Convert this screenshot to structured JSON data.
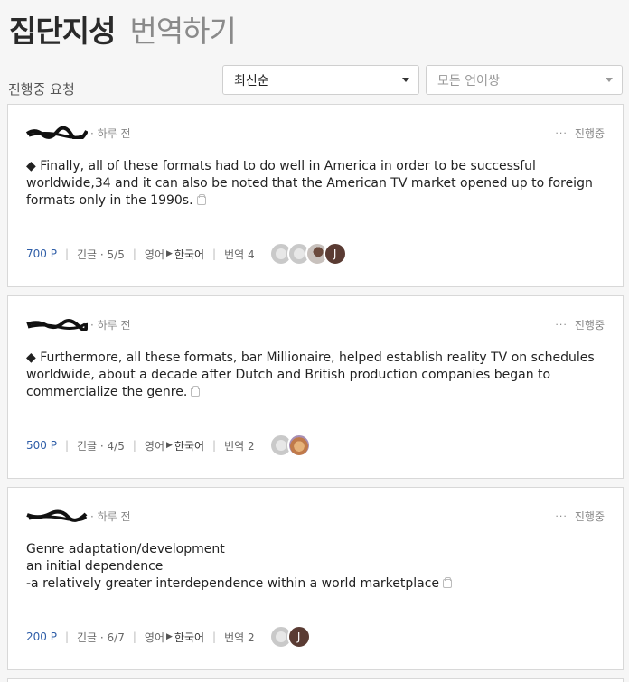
{
  "header": {
    "title_bold": "집단지성",
    "title_light": "번역하기"
  },
  "section_label": "진행중 요청",
  "filters": {
    "sort": {
      "value": "최신순"
    },
    "language_pair": {
      "placeholder": "모든 언어쌍"
    }
  },
  "requests": [
    {
      "time": "· 하루 전",
      "status": "진행중",
      "text": "◆ Finally, all of these formats had to do well in America in order to be successful worldwide,34 and it can also be noted that the American TV market opened up to foreign formats only in the 1990s.",
      "points": "700 P",
      "length": "긴글 · 5/5",
      "source_lang": "영어",
      "target_lang": "한국어",
      "translations": "번역 4",
      "avatars": [
        "grey",
        "grey",
        "photo",
        "J"
      ]
    },
    {
      "time": "· 하루 전",
      "status": "진행중",
      "text": "◆ Furthermore, all these formats, bar Millionaire, helped establish reality TV on schedules worldwide, about a decade after Dutch and British production companies began to commercialize the genre.",
      "points": "500 P",
      "length": "긴글 · 4/5",
      "source_lang": "영어",
      "target_lang": "한국어",
      "translations": "번역 2",
      "avatars": [
        "grey",
        "photo"
      ]
    },
    {
      "time": "· 하루 전",
      "status": "진행중",
      "text": "Genre adaptation/development\nan initial dependence\n-a relatively greater interdependence within a world marketplace",
      "points": "200 P",
      "length": "긴글 · 6/7",
      "source_lang": "영어",
      "target_lang": "한국어",
      "translations": "번역 2",
      "avatars": [
        "grey",
        "J"
      ]
    }
  ]
}
